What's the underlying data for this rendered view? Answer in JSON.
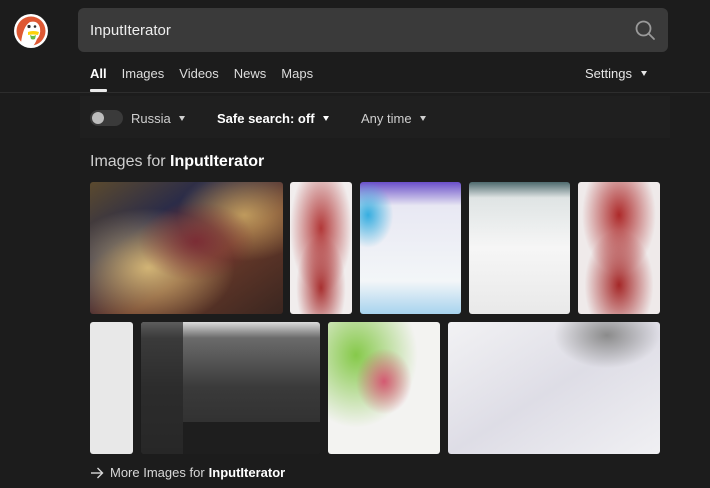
{
  "search": {
    "query": "InputIterator"
  },
  "nav": {
    "tabs": [
      {
        "label": "All",
        "active": true
      },
      {
        "label": "Images",
        "active": false
      },
      {
        "label": "Videos",
        "active": false
      },
      {
        "label": "News",
        "active": false
      },
      {
        "label": "Maps",
        "active": false
      }
    ],
    "settings_label": "Settings"
  },
  "filters": {
    "region_label": "Russia",
    "region_toggle_on": false,
    "safe_search_label": "Safe search: off",
    "time_label": "Any time"
  },
  "images_section": {
    "title_prefix": "Images for",
    "title_query": "InputIterator",
    "more_prefix": "More Images for",
    "more_query": "InputIterator"
  },
  "icons": {
    "logo": "duckduckgo-logo-icon",
    "search": "search-icon",
    "arrow": "arrow-right-icon",
    "caret": "caret-down-icon"
  },
  "colors": {
    "background": "#1c1c1c",
    "search_box": "#3a3a3a",
    "logo_red": "#de5833"
  }
}
